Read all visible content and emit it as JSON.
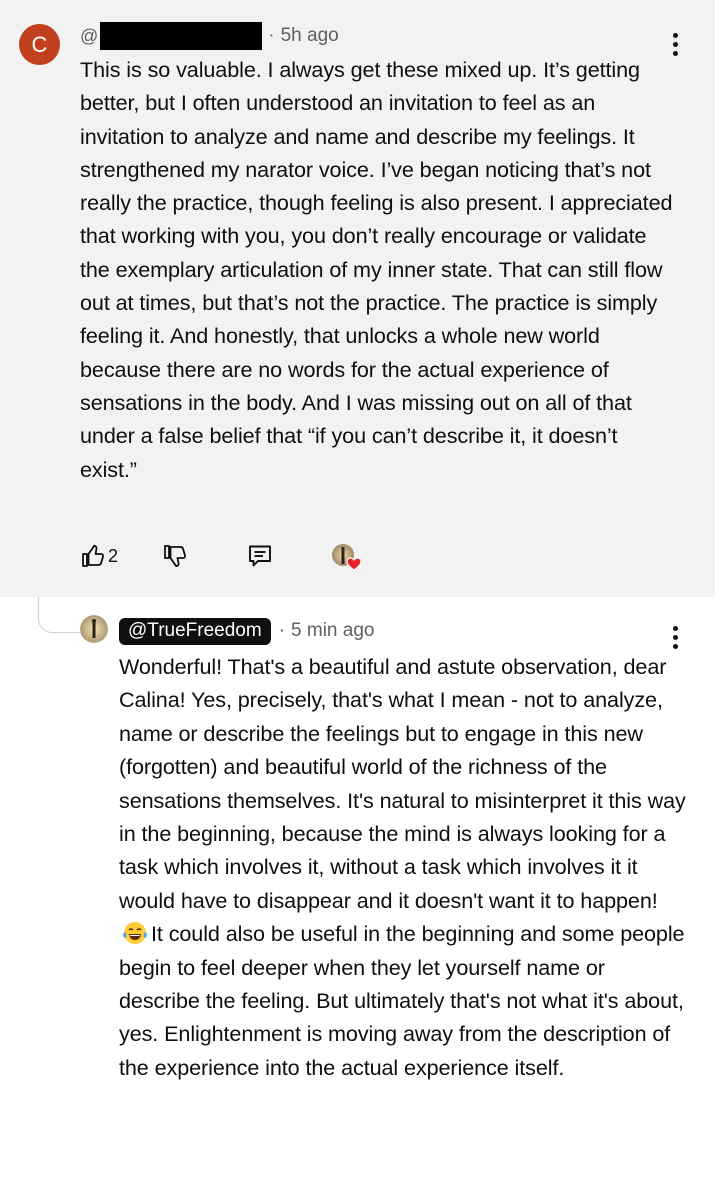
{
  "parent_comment": {
    "avatar_letter": "C",
    "handle_prefix": "@",
    "handle_redacted": true,
    "time": "5h ago",
    "separator": "·",
    "text": "This is so valuable. I always get these mixed up. It’s getting better, but I often understood an invitation to feel as an invitation to analyze and name and describe my feelings. It strengthened my narator voice. I’ve began noticing that’s not really the practice, though feeling is also present. I appreciated that working with you, you don’t really encourage or validate the exemplary articulation of my inner state. That can still flow out at times, but that’s not the practice. The practice is simply feeling it. And honestly, that unlocks a whole new world because there are no words for the actual experience of sensations in the body. And I was missing out on all of that under a false belief that “if you can’t describe it, it doesn’t exist.”",
    "like_count": "2",
    "actions": {
      "like_icon": "thumbs-up-icon",
      "dislike_icon": "thumbs-down-icon",
      "reply_icon": "reply-bubble-icon",
      "creator_heart_icon": "creator-heart-icon"
    }
  },
  "reply_comment": {
    "handle": "@TrueFreedom",
    "time": "5 min ago",
    "separator": "·",
    "text_before_emoji": "Wonderful! That's a beautiful and astute observation, dear Calina! Yes, precisely, that's what I mean - not to analyze, name or describe the feelings but to engage in this new (forgotten) and beautiful world of the richness of the sensations themselves. It's natural to misinterpret it this way in the beginning, because the mind is always looking for a task which involves it, without a task which involves it it would have to disappear and it doesn't want it to happen!",
    "emoji": "face-with-tears-of-joy",
    "text_after_emoji": "It could also be useful in the beginning and some people begin to feel deeper when they let yourself name or describe the feeling. But ultimately that's not what it's about, yes. Enlightenment is moving away from the description of the experience into the actual experience itself."
  },
  "colors": {
    "parent_background": "#f2f2f2",
    "avatar_c": "#c1401d",
    "handle_pill": "#0f0f0f",
    "heart": "#e8202a",
    "meta_text": "#606060"
  }
}
